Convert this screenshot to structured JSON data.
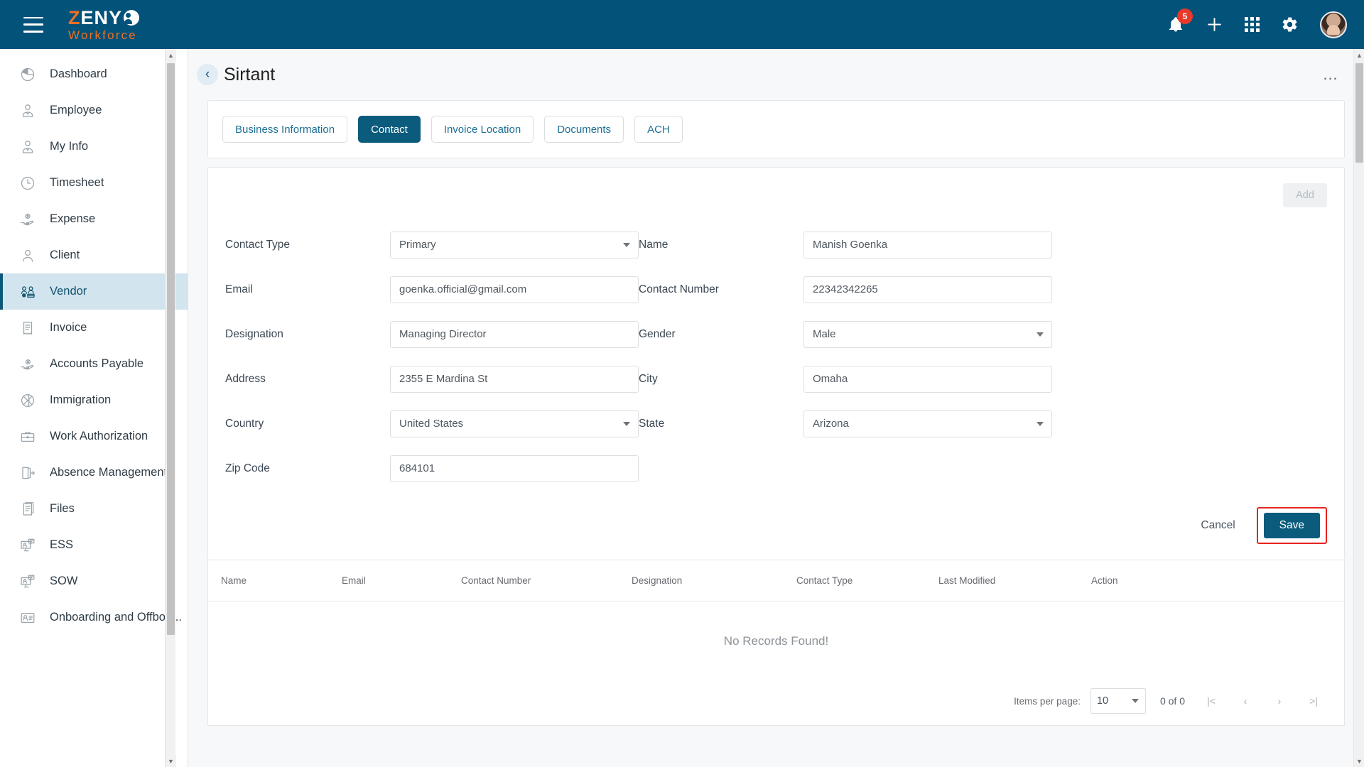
{
  "topbar": {
    "menu_icon": "hamburger-icon",
    "brand": {
      "z": "Z",
      "eny": "ENY",
      "sub": "Workforce"
    },
    "notifications_count": "5",
    "icons": [
      "bell-icon",
      "plus-icon",
      "apps-grid-icon",
      "gear-icon",
      "avatar"
    ]
  },
  "sidebar": {
    "items": [
      {
        "label": "Dashboard",
        "icon": "pie-chart-icon",
        "active": false
      },
      {
        "label": "Employee",
        "icon": "employee-icon",
        "active": false
      },
      {
        "label": "My Info",
        "icon": "employee-icon",
        "active": false
      },
      {
        "label": "Timesheet",
        "icon": "clock-icon",
        "active": false
      },
      {
        "label": "Expense",
        "icon": "hand-money-icon",
        "active": false
      },
      {
        "label": "Client",
        "icon": "person-icon",
        "active": false
      },
      {
        "label": "Vendor",
        "icon": "vendor-icon",
        "active": true
      },
      {
        "label": "Invoice",
        "icon": "invoice-icon",
        "active": false
      },
      {
        "label": "Accounts Payable",
        "icon": "hand-coin-icon",
        "active": false
      },
      {
        "label": "Immigration",
        "icon": "globe-plane-icon",
        "active": false
      },
      {
        "label": "Work Authorization",
        "icon": "briefcase-icon",
        "active": false
      },
      {
        "label": "Absence Management",
        "icon": "door-exit-icon",
        "active": false
      },
      {
        "label": "Files",
        "icon": "documents-icon",
        "active": false
      },
      {
        "label": "ESS",
        "icon": "monitor-chat-icon",
        "active": false
      },
      {
        "label": "SOW",
        "icon": "monitor-chat-icon",
        "active": false
      },
      {
        "label": "Onboarding and Offboa...",
        "icon": "id-card-icon",
        "active": false
      }
    ]
  },
  "page": {
    "back_icon": "chevron-left-icon",
    "title": "Sirtant",
    "more_icon": "ellipsis-icon",
    "more_label": "…"
  },
  "tabs": [
    {
      "label": "Business Information",
      "active": false
    },
    {
      "label": "Contact",
      "active": true
    },
    {
      "label": "Invoice Location",
      "active": false
    },
    {
      "label": "Documents",
      "active": false
    },
    {
      "label": "ACH",
      "active": false
    }
  ],
  "form": {
    "add_label": "Add",
    "fields": [
      {
        "label": "Contact Type",
        "type": "select",
        "value": "Primary"
      },
      {
        "label": "Name",
        "type": "text",
        "value": "Manish Goenka"
      },
      {
        "label": "Email",
        "type": "text",
        "value": "goenka.official@gmail.com"
      },
      {
        "label": "Contact Number",
        "type": "text",
        "value": "22342342265"
      },
      {
        "label": "Designation",
        "type": "text",
        "value": "Managing Director"
      },
      {
        "label": "Gender",
        "type": "select",
        "value": "Male"
      },
      {
        "label": "Address",
        "type": "text",
        "value": "2355 E Mardina St"
      },
      {
        "label": "City",
        "type": "text",
        "value": "Omaha"
      },
      {
        "label": "Country",
        "type": "select",
        "value": "United States"
      },
      {
        "label": "State",
        "type": "select",
        "value": "Arizona"
      },
      {
        "label": "Zip Code",
        "type": "text",
        "value": "684101"
      }
    ],
    "cancel_label": "Cancel",
    "save_label": "Save",
    "save_highlight_color": "#e8231e"
  },
  "table": {
    "columns": [
      "Name",
      "Email",
      "Contact Number",
      "Designation",
      "Contact Type",
      "Last Modified",
      "Action"
    ],
    "empty_message": "No Records Found!",
    "paginator": {
      "items_per_page_label": "Items per page:",
      "page_size": "10",
      "range_label": "0 of 0",
      "first_icon": "|<",
      "prev_icon": "‹",
      "next_icon": "›",
      "last_icon": ">|"
    }
  },
  "theme": {
    "header_blue": "#02527a",
    "accent_orange": "#f07023",
    "active_nav_bg": "#d2e4ee",
    "primary_button": "#0b5b7c"
  }
}
